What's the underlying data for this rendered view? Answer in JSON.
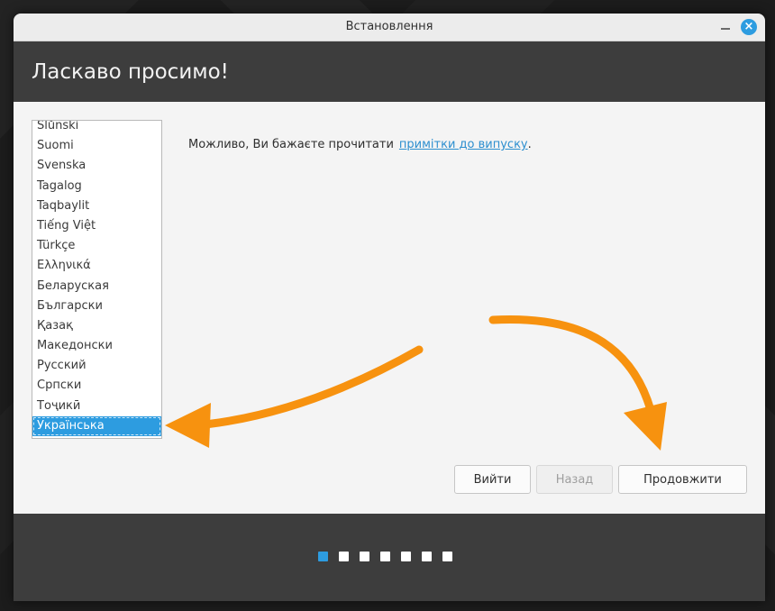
{
  "window": {
    "title": "Встановлення"
  },
  "header": {
    "heading": "Ласкаво просимо!"
  },
  "languages": {
    "items": [
      "Ślůnski",
      "Suomi",
      "Svenska",
      "Tagalog",
      "Taqbaylit",
      "Tiếng Việt",
      "Türkçe",
      "Ελληνικά",
      "Беларуская",
      "Български",
      "Қазақ",
      "Македонски",
      "Русский",
      "Српски",
      "Тоҷикӣ",
      "Українська"
    ],
    "selected": "Українська"
  },
  "notes": {
    "text": "Можливо, Ви бажаєте прочитати",
    "link_text": "примітки до випуску",
    "suffix": "."
  },
  "buttons": {
    "quit": "Вийти",
    "back": "Назад",
    "continue": "Продовжити"
  },
  "progress": {
    "total_steps": 7,
    "current_step": 1
  },
  "colors": {
    "accent": "#2d9ce0",
    "annotation_arrow": "#f7920f"
  },
  "icons": {
    "close": "close-icon",
    "minimize": "minimize-icon"
  }
}
